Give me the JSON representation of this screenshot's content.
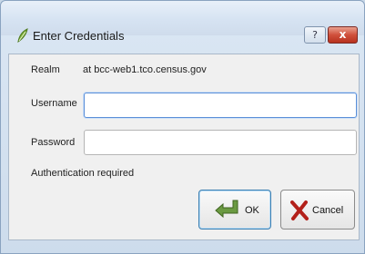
{
  "window": {
    "title": "Enter Credentials",
    "help_label": "?",
    "close_label": "x"
  },
  "form": {
    "realm_label": "Realm",
    "realm_value": "at bcc-web1.tco.census.gov",
    "username_label": "Username",
    "username_value": "",
    "password_label": "Password",
    "password_value": "",
    "status_text": "Authentication required"
  },
  "buttons": {
    "ok_label": "OK",
    "cancel_label": "Cancel"
  },
  "colors": {
    "ok_icon": "#5f8f3a",
    "cancel_icon": "#b3201a"
  }
}
